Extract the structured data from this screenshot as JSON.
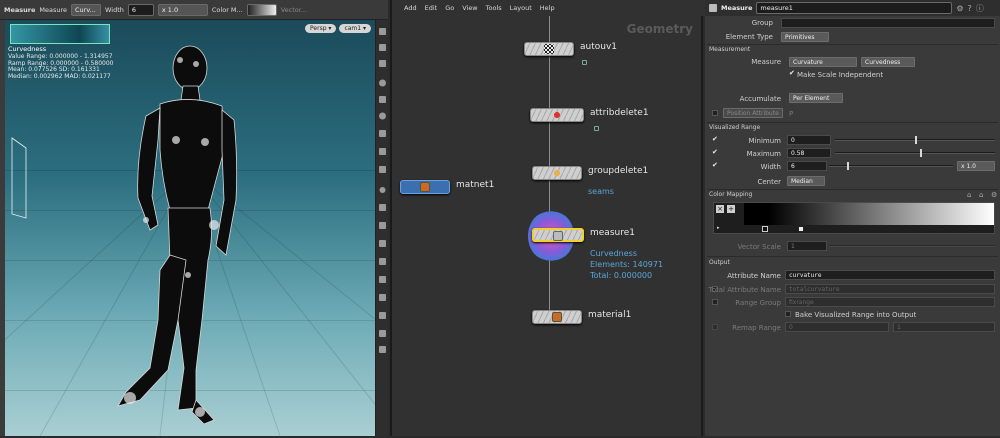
{
  "viewport": {
    "toolbar": {
      "measure_label": "Measure",
      "measure_type_label": "Measure",
      "measure_type_value": "Curv...",
      "width_label": "Width",
      "width_value": "6",
      "scale_value": "x 1.0",
      "color_map_label": "Color M...",
      "vector_label": "Vector..."
    },
    "camera_buttons": [
      "Persp ▾",
      "cam1 ▾"
    ],
    "hud": {
      "title": "Curvedness",
      "value_range": "Value Range: 0.000000 - 1.314957",
      "ramp_range": "Ramp Range: 0.000000 - 0.580000",
      "mean_sd": "Mean: 0.077526  SD: 0.161331",
      "median_mad": "Median: 0.002962  MAD: 0.021177"
    }
  },
  "network": {
    "menu": [
      "Add",
      "Edit",
      "Go",
      "View",
      "Tools",
      "Layout",
      "Help"
    ],
    "context_label": "Geometry",
    "nodes": [
      {
        "name": "autouv1"
      },
      {
        "name": "attribdelete1"
      },
      {
        "name": "groupdelete1",
        "sub": "seams"
      },
      {
        "name": "measure1",
        "info": [
          "Curvedness",
          "Elements: 140971",
          "Total: 0.000000"
        ]
      },
      {
        "name": "material1"
      },
      {
        "name": "matnet1"
      }
    ]
  },
  "params": {
    "header_type": "Measure",
    "header_name": "measure1",
    "group_label": "Group",
    "element_type_label": "Element Type",
    "element_type_value": "Primitives",
    "measurement_section": "Measurement",
    "measure_label": "Measure",
    "measure_value": "Curvature",
    "measure_sub_value": "Curvedness",
    "make_scale_independent": "Make Scale Independent",
    "accumulate_label": "Accumulate",
    "accumulate_value": "Per Element",
    "position_attribute_label": "Position Attribute",
    "position_attribute_value": "P",
    "visualized_range_section": "Visualized Range",
    "minimum_label": "Minimum",
    "minimum_value": "0",
    "minimum_fraction": 0.0,
    "maximum_label": "Maximum",
    "maximum_value": "0.58",
    "width_label": "Width",
    "width_value": "6",
    "width_scale": "x 1.0",
    "center_label": "Center",
    "center_value": "Median",
    "color_mapping_section": "Color Mapping",
    "vector_scale_label": "Vector Scale",
    "vector_scale_value": "1",
    "output_section": "Output",
    "attribute_name_label": "Attribute Name",
    "attribute_name_value": "curvature",
    "total_attribute_name_label": "Total Attribute Name",
    "total_attribute_name_value": "totalcurvature",
    "range_group_label": "Range Group",
    "range_group_value": "fixrange",
    "bake_label": "Bake Visualized Range into Output",
    "remap_range_label": "Remap Range",
    "remap_range_values": [
      "0",
      "1"
    ]
  },
  "colors": {
    "accent_blue": "#5ca6d8",
    "viewport_top": "#1b4b5a",
    "viewport_bottom": "#a9cfd3",
    "node_selected": "#f2d22a"
  },
  "icons": [
    "gear-icon",
    "help-icon",
    "info-icon",
    "lock-icon",
    "home-icon"
  ]
}
